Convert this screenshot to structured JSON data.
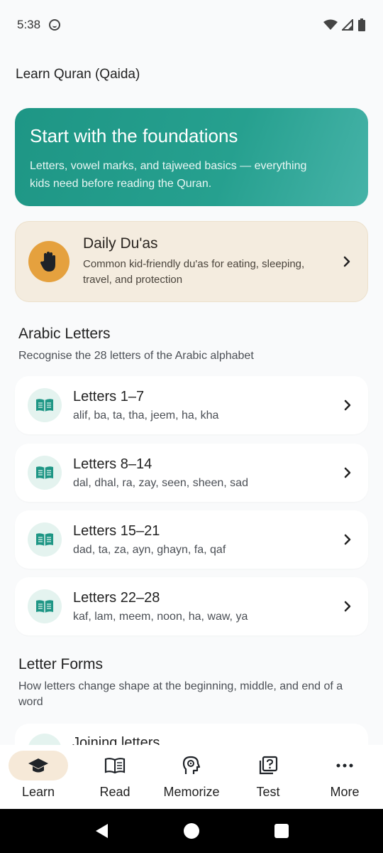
{
  "status": {
    "time": "5:38"
  },
  "app": {
    "title": "Learn Quran (Qaida)"
  },
  "hero": {
    "title": "Start with the foundations",
    "subtitle": "Letters, vowel marks, and tajweed basics — everything kids need before reading the Quran."
  },
  "dua": {
    "title": "Daily Du'as",
    "subtitle": "Common kid-friendly du'as for eating, sleeping, travel, and protection",
    "icon": "raised-hand-icon"
  },
  "sections": {
    "arabic_letters": {
      "title": "Arabic Letters",
      "subtitle": "Recognise the 28 letters of the Arabic alphabet",
      "items": [
        {
          "title": "Letters 1–7",
          "subtitle": "alif, ba, ta, tha, jeem, ha, kha"
        },
        {
          "title": "Letters 8–14",
          "subtitle": "dal, dhal, ra, zay, seen, sheen, sad"
        },
        {
          "title": "Letters 15–21",
          "subtitle": "dad, ta, za, ayn, ghayn, fa, qaf"
        },
        {
          "title": "Letters 22–28",
          "subtitle": "kaf, lam, meem, noon, ha, waw, ya"
        }
      ]
    },
    "letter_forms": {
      "title": "Letter Forms",
      "subtitle": "How letters change shape at the beginning, middle, and end of a word",
      "items": [
        {
          "title": "Joining letters"
        }
      ]
    }
  },
  "bottom_nav": [
    {
      "label": "Learn",
      "icon": "graduation-cap-icon",
      "active": true
    },
    {
      "label": "Read",
      "icon": "open-book-icon",
      "active": false
    },
    {
      "label": "Memorize",
      "icon": "brain-head-icon",
      "active": false
    },
    {
      "label": "Test",
      "icon": "quiz-icon",
      "active": false
    },
    {
      "label": "More",
      "icon": "more-dots-icon",
      "active": false
    }
  ],
  "colors": {
    "accent_teal": "#1e9685",
    "dua_bg": "#f4ecdf",
    "dua_icon_bg": "#e5a13e",
    "nav_active_bg": "#f6e9d8"
  }
}
